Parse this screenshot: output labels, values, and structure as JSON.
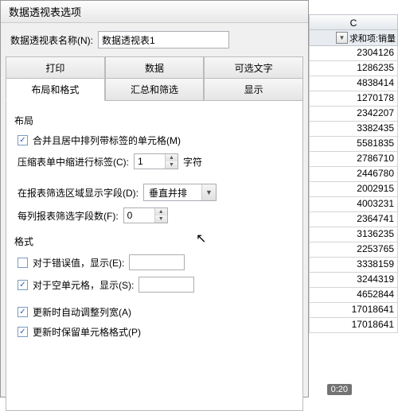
{
  "dialog": {
    "title": "数据透视表选项",
    "name_label": "数据透视表名称(N):",
    "name_value": "数据透视表1",
    "tabs_row1": [
      "打印",
      "数据",
      "可选文字"
    ],
    "tabs_row2": [
      "布局和格式",
      "汇总和筛选",
      "显示"
    ],
    "active_tab": "布局和格式",
    "layout": {
      "section": "布局",
      "merge_label": "合并且居中排列带标签的单元格(M)",
      "merge_checked": true,
      "indent_label": "压缩表单中缩进行标签(C):",
      "indent_value": "1",
      "indent_unit": "字符",
      "filter_area_label": "在报表筛选区域显示字段(D):",
      "filter_area_value": "垂直并排",
      "fields_per_label": "每列报表筛选字段数(F):",
      "fields_per_value": "0"
    },
    "format": {
      "section": "格式",
      "error_label": "对于错误值，显示(E):",
      "error_checked": false,
      "error_value": "",
      "empty_label": "对于空单元格，显示(S):",
      "empty_checked": true,
      "empty_value": "",
      "autofit_label": "更新时自动调整列宽(A)",
      "autofit_checked": true,
      "preserve_label": "更新时保留单元格格式(P)",
      "preserve_checked": true
    }
  },
  "sheet": {
    "column_letter": "C",
    "header_label": "求和项:销量",
    "values": [
      "2304126",
      "1286235",
      "4838414",
      "1270178",
      "2342207",
      "3382435",
      "5581835",
      "2786710",
      "2446780",
      "2002915",
      "4003231",
      "2364741",
      "3136235",
      "2253765",
      "3338159",
      "3244319",
      "4652844",
      "17018641",
      "17018641"
    ]
  },
  "video": {
    "time": "0:20"
  }
}
